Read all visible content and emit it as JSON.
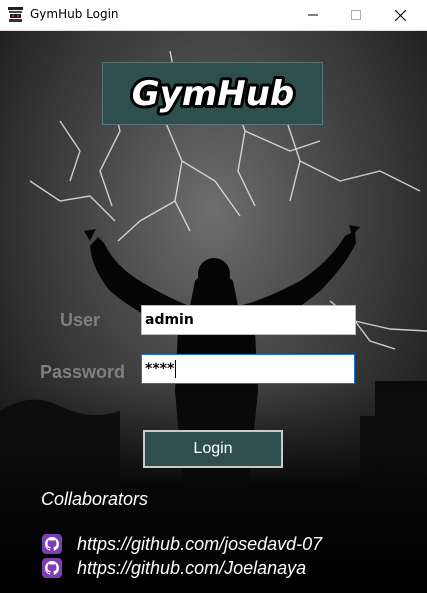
{
  "window": {
    "title": "GymHub Login",
    "controls": [
      "minimize",
      "maximize",
      "close"
    ],
    "icon": "gym-equipment-icon"
  },
  "logo": {
    "text": "GymHub",
    "background": "#2f4f4f"
  },
  "form": {
    "user_label": "User",
    "user_value": "admin",
    "password_label": "Password",
    "password_value": "****",
    "login_label": "Login"
  },
  "collaborators": {
    "title": "Collaborators",
    "links": [
      {
        "icon": "github-icon",
        "url": "https://github.com/josedavd-07"
      },
      {
        "icon": "github-icon",
        "url": "https://github.com/Joelanaya"
      }
    ]
  },
  "colors": {
    "accent": "#2f4f4f",
    "label": "#7f7f7f",
    "focus_border": "#1e72c9",
    "github_badge": "#7b3fb0"
  }
}
